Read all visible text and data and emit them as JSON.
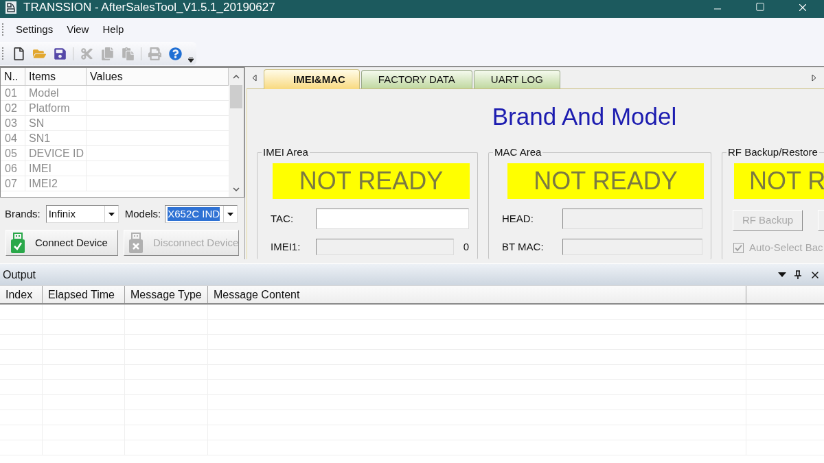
{
  "window": {
    "title": "TRANSSION - AfterSalesTool_V1.5.1_20190627"
  },
  "menu": [
    "Settings",
    "View",
    "Help"
  ],
  "toolbar": [
    [
      {
        "kind": "new",
        "disabled": false
      },
      {
        "kind": "open",
        "disabled": false
      },
      {
        "kind": "save",
        "disabled": false
      }
    ],
    [
      {
        "kind": "cut",
        "disabled": true
      },
      {
        "kind": "copy",
        "disabled": true
      },
      {
        "kind": "paste",
        "disabled": true
      }
    ],
    [
      {
        "kind": "print",
        "disabled": true
      },
      {
        "kind": "help",
        "disabled": false
      }
    ]
  ],
  "info_table": {
    "columns": [
      "N..",
      "Items",
      "Values"
    ],
    "rows": [
      {
        "number": "01",
        "item": "Model"
      },
      {
        "number": "02",
        "item": "Platform"
      },
      {
        "number": "03",
        "item": "SN"
      },
      {
        "number": "04",
        "item": "SN1"
      },
      {
        "number": "05",
        "item": "DEVICE ID"
      },
      {
        "number": "06",
        "item": "IMEI"
      },
      {
        "number": "07",
        "item": "IMEI2"
      }
    ]
  },
  "device_selector": {
    "brand": {
      "label": "Brands:",
      "value": "Infinix",
      "highlighted": false
    },
    "model": {
      "label": "Models:",
      "value": "X652C IND",
      "highlighted": true
    }
  },
  "device_buttons": [
    {
      "kind": "connect",
      "label": "Connect Device",
      "disabled": false
    },
    {
      "kind": "disconnect",
      "label": "Disconnect Device",
      "disabled": true
    }
  ],
  "tabs": [
    {
      "label": "IMEI&MAC",
      "selected": true
    },
    {
      "label": "FACTORY DATA",
      "selected": false
    },
    {
      "label": "UART LOG",
      "selected": false
    }
  ],
  "heading": "Brand And Model",
  "groups": [
    {
      "kind": "fields",
      "title": "IMEI Area",
      "status": "NOT READY",
      "fields": [
        {
          "label": "TAC:",
          "disabled": false
        },
        {
          "label": "IMEI1:",
          "disabled": true,
          "suffix": "0"
        }
      ]
    },
    {
      "kind": "fields",
      "title": "MAC Area",
      "status": "NOT READY",
      "fields": [
        {
          "label": "HEAD:",
          "disabled": true
        },
        {
          "label": "BT MAC:",
          "disabled": true
        }
      ]
    },
    {
      "kind": "backup",
      "title": "RF Backup/Restore",
      "status": "NOT R",
      "button": {
        "label": "RF Backup",
        "disabled": true
      },
      "checkbox": {
        "label": "Auto-Select Bac",
        "checked": true,
        "disabled": true
      }
    }
  ],
  "output": {
    "title": "Output",
    "columns": [
      "Index",
      "Elapsed Time",
      "Message Type",
      "Message Content"
    ]
  }
}
